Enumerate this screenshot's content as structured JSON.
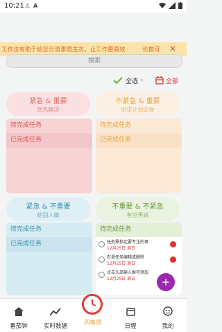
{
  "status_bar": {
    "time": "10:21",
    "notif_icons": [
      "alert-icon",
      "a-icon"
    ],
    "right_icons": [
      "wifi-icon",
      "signal-icon",
      "battery-icon"
    ]
  },
  "banner": {
    "text": "工作法有助于给您分清事情主次，让工作更高效",
    "button": "长按可",
    "close": "×"
  },
  "search": {
    "placeholder": "搜索"
  },
  "toolbar": {
    "select_all": "全选",
    "calendar_label": "全部"
  },
  "quadrants": {
    "q1": {
      "title": "紧急 & 重要",
      "subtitle": "优先解决",
      "rows": [
        "待完成任务",
        "已完成任务"
      ],
      "color": "#f7d3d5"
    },
    "q2": {
      "title": "不紧急 & 重要",
      "subtitle": "制定计划去做",
      "rows": [
        "待完成任务",
        "已完成任务"
      ],
      "color": "#fbe9d6"
    },
    "q3": {
      "title": "紧急 & 不重要",
      "subtitle": "给别人做",
      "rows": [
        "待完成任务",
        "已完成任务"
      ],
      "color": "#d6ecf3"
    },
    "q4": {
      "title": "不重要 & 不紧急",
      "subtitle": "有空再说",
      "rows": [
        "待完成任务"
      ],
      "color": "#e5eed9",
      "tasks": [
        {
          "text": "任务需指定要专注的事",
          "date": "12月25日 周日"
        },
        {
          "text": "右滑任务编辑或删除",
          "date": "12月25日 周日"
        },
        {
          "text": "点击头部输入框可添加",
          "date": "12月25日 周日"
        }
      ]
    }
  },
  "fab": {
    "label": "+"
  },
  "bottom_nav": [
    {
      "label": "番茄钟",
      "icon": "home-icon"
    },
    {
      "label": "实时数据",
      "icon": "chart-icon"
    },
    {
      "label": "四象限",
      "icon": "clock-icon",
      "active": true
    },
    {
      "label": "日程",
      "icon": "calendar-icon"
    },
    {
      "label": "我的",
      "icon": "profile-icon"
    }
  ]
}
